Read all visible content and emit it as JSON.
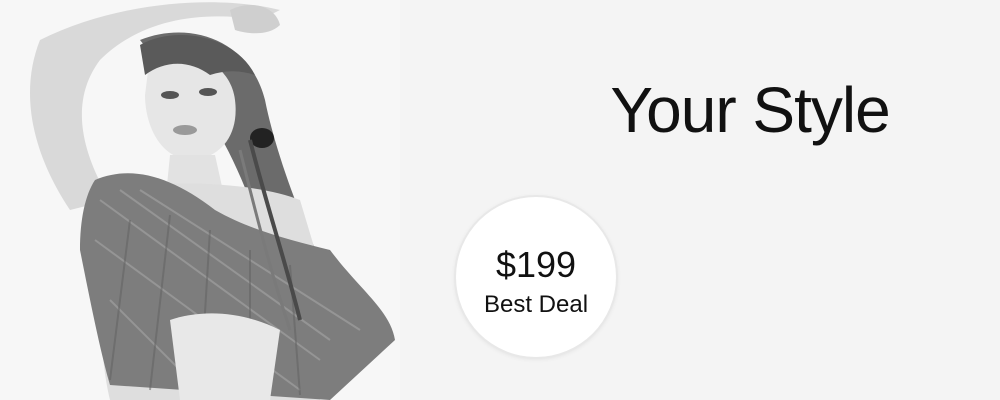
{
  "banner": {
    "headline": "Your Style",
    "badge": {
      "price": "$199",
      "label": "Best Deal"
    },
    "photo": {
      "description_icon": "model-photo"
    }
  },
  "colors": {
    "background": "#f4f4f4",
    "text": "#111111",
    "badge_bg": "#ffffff"
  }
}
